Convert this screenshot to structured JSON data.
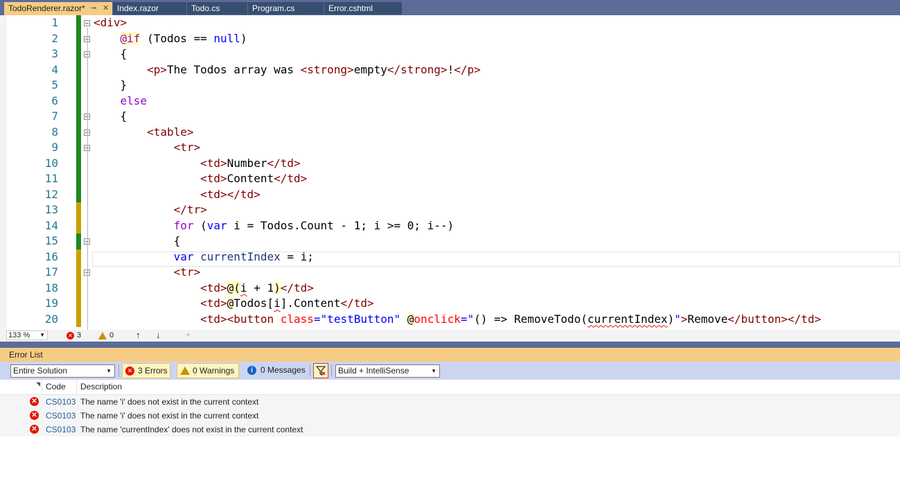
{
  "tabs": [
    {
      "label": "TodoRenderer.razor*",
      "active": true
    },
    {
      "label": "Index.razor",
      "active": false
    },
    {
      "label": "Todo.cs",
      "active": false
    },
    {
      "label": "Program.cs",
      "active": false
    },
    {
      "label": "Error.cshtml",
      "active": false
    }
  ],
  "tab_icons": {
    "pin": "pin-icon",
    "close": "close-icon"
  },
  "editor": {
    "line_numbers": [
      "1",
      "2",
      "3",
      "4",
      "5",
      "6",
      "7",
      "8",
      "9",
      "10",
      "11",
      "12",
      "13",
      "14",
      "15",
      "16",
      "17",
      "18",
      "19",
      "20"
    ],
    "current_line": "16",
    "lines": {
      "l1": {
        "t1": "<div>"
      },
      "l2": {
        "t1": "    ",
        "razor": "@if",
        "t2": " (Todos == ",
        "kw": "null",
        "t3": ")"
      },
      "l3": {
        "t1": "    {"
      },
      "l4": {
        "t1": "        ",
        "tag1": "<p>",
        "text1": "The Todos array was ",
        "tag2": "<strong>",
        "text2": "empty",
        "tag3": "</strong>",
        "text3": "!",
        "tag4": "</p>"
      },
      "l5": {
        "t1": "    }"
      },
      "l6": {
        "t1": "    ",
        "kw": "else"
      },
      "l7": {
        "t1": "    {"
      },
      "l8": {
        "t1": "        ",
        "tag": "<table>"
      },
      "l9": {
        "t1": "            ",
        "tag": "<tr>"
      },
      "l10": {
        "t1": "                ",
        "tag1": "<td>",
        "text": "Number",
        "tag2": "</td>"
      },
      "l11": {
        "t1": "                ",
        "tag1": "<td>",
        "text": "Content",
        "tag2": "</td>"
      },
      "l12": {
        "t1": "                ",
        "tag1": "<td></td>"
      },
      "l13": {
        "t1": "            ",
        "tag": "</tr>"
      },
      "l14": {
        "t1": "            ",
        "kw1": "for",
        "t2": " (",
        "kw2": "var",
        "t3": " i = Todos.Count - 1; i >= 0; i--)"
      },
      "l15": {
        "t1": "            {"
      },
      "l16": {
        "t1": "            ",
        "kw": "var",
        "t2": " ",
        "var": "currentIndex",
        "t3": " = i;"
      },
      "l17": {
        "t1": "            ",
        "tag": "<tr>"
      },
      "l18": {
        "t1": "                ",
        "tag1": "<td>",
        "razor1": "@(",
        "sq": "i",
        "t2": " + 1",
        "razor2": ")",
        "tag2": "</td>"
      },
      "l19": {
        "t1": "                ",
        "tag1": "<td>",
        "razor": "@",
        "t2": "Todos[",
        "sq": "i",
        "t3": "].Content",
        "tag2": "</td>"
      },
      "l20": {
        "t1": "                ",
        "tag1": "<td><button",
        "t2": " ",
        "attr1": "class",
        "t3": "=",
        "str1": "\"testButton\"",
        "t4": " ",
        "razor": "@",
        "attr2": "onclick",
        "t5": "=",
        "str2": "\"",
        "t6": "() => RemoveTodo(",
        "sq": "currentIndex",
        "t7": ")",
        "str3": "\"",
        "tag2": ">",
        "text": "Remove",
        "tag3": "</button></td>"
      }
    }
  },
  "editor_status": {
    "zoom": "133 %",
    "error_count": "3",
    "warning_count": "0",
    "up_arrow": "↑",
    "down_arrow": "↓",
    "left_arrow": "◂"
  },
  "error_list": {
    "title": "Error List",
    "scope": "Entire Solution",
    "errors_button": "3 Errors",
    "warnings_button": "0 Warnings",
    "messages_button": "0 Messages",
    "filter_source": "Build + IntelliSense",
    "columns": {
      "code": "Code",
      "description": "Description"
    },
    "rows": [
      {
        "code": "CS0103",
        "description": "The name 'i' does not exist in the current context"
      },
      {
        "code": "CS0103",
        "description": "The name 'i' does not exist in the current context"
      },
      {
        "code": "CS0103",
        "description": "The name 'currentIndex' does not exist in the current context"
      }
    ]
  },
  "colors": {
    "accent_tab": "#f5cc84",
    "error_red": "#e51400",
    "warning_yellow": "#c89300",
    "saved_green": "#1e8a1e",
    "unsaved_yellow": "#c8a000"
  }
}
